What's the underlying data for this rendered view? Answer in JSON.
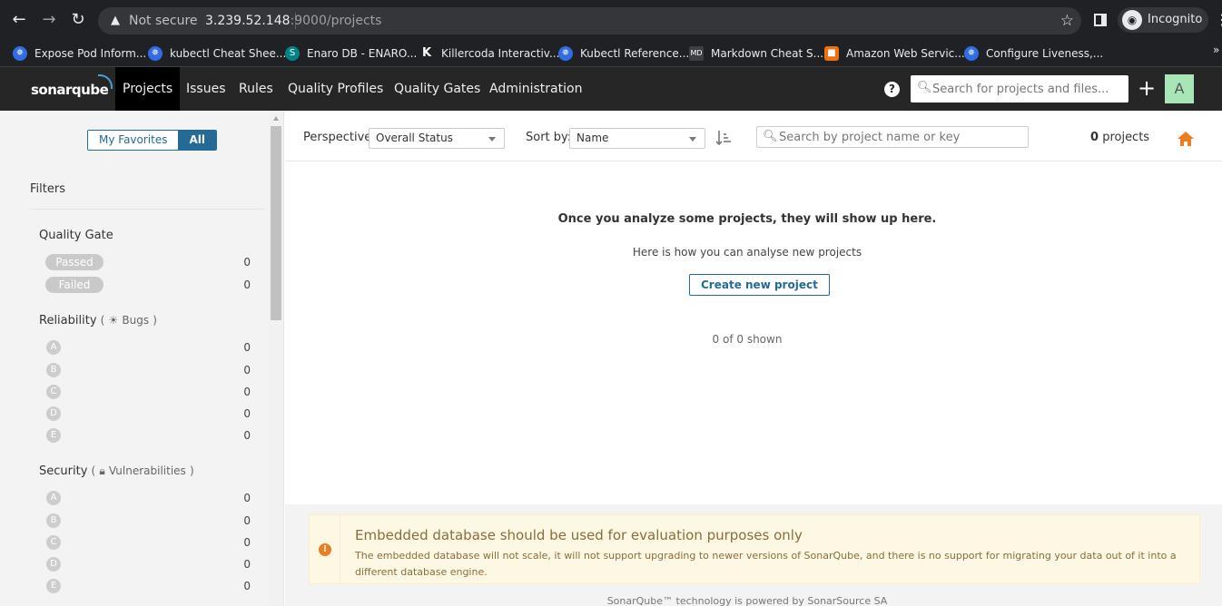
{
  "browser": {
    "security_label": "Not secure",
    "url_host": "3.239.52.148",
    "url_rest": ":9000/projects",
    "profile_label": "Incognito",
    "bookmarks": [
      {
        "label": "Expose Pod Inform...",
        "icon": "kubernetes-icon",
        "color": "#326ce5"
      },
      {
        "label": "kubectl Cheat Shee...",
        "icon": "kubernetes-icon",
        "color": "#326ce5"
      },
      {
        "label": "Enaro DB - ENARO...",
        "icon": "sharepoint-icon",
        "color": "#038387"
      },
      {
        "label": "Killercoda Interactiv...",
        "icon": "killercoda-icon",
        "color": "#202124"
      },
      {
        "label": "Kubectl Reference...",
        "icon": "kubernetes-icon",
        "color": "#326ce5"
      },
      {
        "label": "Markdown Cheat S...",
        "icon": "markdown-icon",
        "color": "#3c4043"
      },
      {
        "label": "Amazon Web Servic...",
        "icon": "aws-icon",
        "color": "#ec7211"
      },
      {
        "label": "Configure Liveness,...",
        "icon": "kubernetes-icon",
        "color": "#326ce5"
      }
    ],
    "bookmarks_overflow": "»"
  },
  "navbar": {
    "logo": "sonarqube",
    "items": [
      {
        "label": "Projects",
        "active": true
      },
      {
        "label": "Issues",
        "active": false
      },
      {
        "label": "Rules",
        "active": false
      },
      {
        "label": "Quality Profiles",
        "active": false
      },
      {
        "label": "Quality Gates",
        "active": false
      },
      {
        "label": "Administration",
        "active": false
      }
    ],
    "search_placeholder": "Search for projects and files...",
    "avatar_letter": "A",
    "avatar_color": "#a8e6b8"
  },
  "sidebar": {
    "toggle": {
      "favorites": "My Favorites",
      "all": "All",
      "selected": "All"
    },
    "filters_title": "Filters",
    "quality_gate": {
      "title": "Quality Gate",
      "options": [
        {
          "label": "Passed",
          "count": "0"
        },
        {
          "label": "Failed",
          "count": "0"
        }
      ]
    },
    "reliability": {
      "title": "Reliability",
      "sub": "Bugs",
      "icon": "bug-icon",
      "ratings": [
        {
          "label": "A",
          "count": "0"
        },
        {
          "label": "B",
          "count": "0"
        },
        {
          "label": "C",
          "count": "0"
        },
        {
          "label": "D",
          "count": "0"
        },
        {
          "label": "E",
          "count": "0"
        }
      ]
    },
    "security": {
      "title": "Security",
      "sub": "Vulnerabilities",
      "icon": "lock-icon",
      "ratings": [
        {
          "label": "A",
          "count": "0"
        },
        {
          "label": "B",
          "count": "0"
        },
        {
          "label": "C",
          "count": "0"
        },
        {
          "label": "D",
          "count": "0"
        },
        {
          "label": "E",
          "count": "0"
        }
      ]
    }
  },
  "main": {
    "perspective_label": "Perspective:",
    "perspective_value": "Overall Status",
    "sort_label": "Sort by:",
    "sort_value": "Name",
    "search_placeholder": "Search by project name or key",
    "project_count": "0",
    "project_count_label": "projects",
    "empty_heading": "Once you analyze some projects, they will show up here.",
    "empty_sub": "Here is how you can analyse new projects",
    "create_button": "Create new project",
    "shown_text": "0 of 0 shown",
    "accent_color": "#236a97",
    "home_color": "#ed7d20"
  },
  "alert": {
    "title": "Embedded database should be used for evaluation purposes only",
    "body": "The embedded database will not scale, it will not support upgrading to newer versions of SonarQube, and there is no support for migrating your data out of it into a different database engine."
  },
  "footer": {
    "powered": "SonarQube™ technology is powered by SonarSource SA"
  }
}
